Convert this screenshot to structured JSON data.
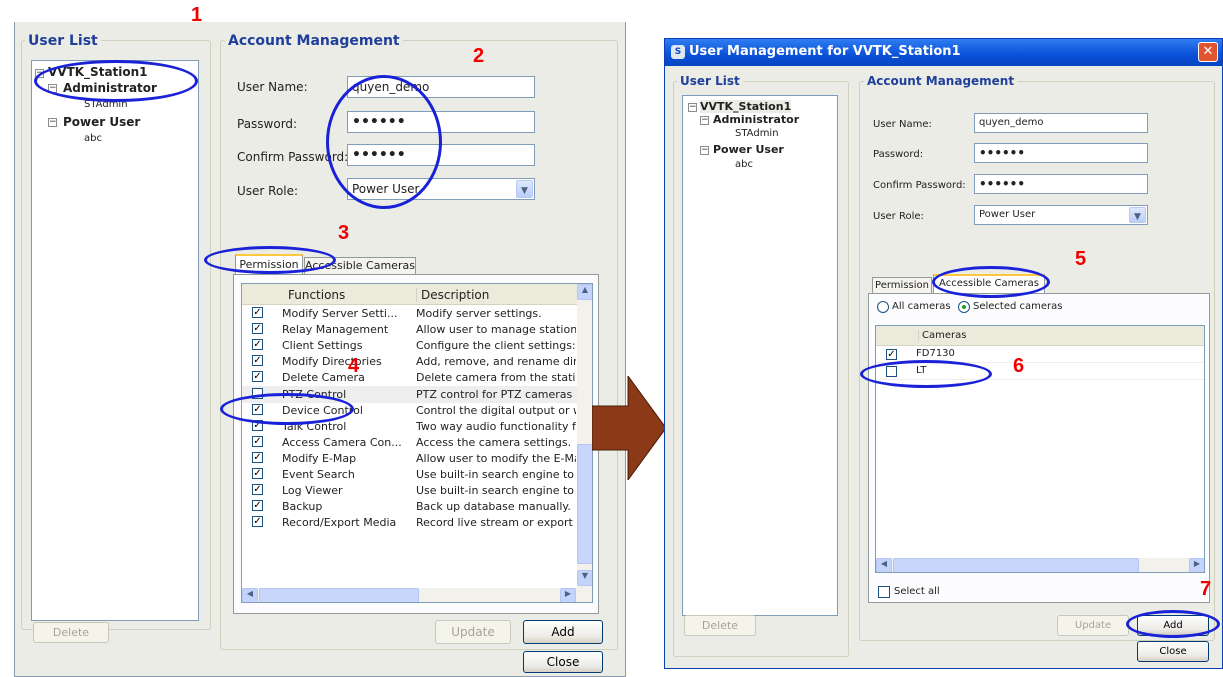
{
  "left": {
    "user_list_title": "User List",
    "tree": {
      "station": "VVTK_Station1",
      "group1": "Administrator",
      "group1_user": "STAdmin",
      "group2": "Power User",
      "group2_user": "abc"
    },
    "delete_label": "Delete",
    "account_title": "Account Management",
    "form": {
      "user_name_label": "User Name:",
      "user_name_value": "quyen_demo",
      "password_label": "Password:",
      "password_value": "••••••",
      "confirm_label": "Confirm Password:",
      "confirm_value": "••••••",
      "role_label": "User Role:",
      "role_value": "Power User"
    },
    "tabs": {
      "permission": "Permission",
      "cameras": "Accessible Cameras"
    },
    "columns": {
      "functions": "Functions",
      "description": "Description"
    },
    "permissions": [
      {
        "checked": true,
        "name": "Modify Server Setti...",
        "desc": "Modify server settings."
      },
      {
        "checked": true,
        "name": "Relay Management",
        "desc": "Allow user to manage station i"
      },
      {
        "checked": true,
        "name": "Client Settings",
        "desc": "Configure the client settings: :"
      },
      {
        "checked": true,
        "name": "Modify Directories",
        "desc": "Add, remove, and rename dire"
      },
      {
        "checked": true,
        "name": "Delete Camera",
        "desc": "Delete camera from the statio"
      },
      {
        "checked": false,
        "name": "PTZ Control",
        "desc": "PTZ control for PTZ cameras a"
      },
      {
        "checked": true,
        "name": "Device Control",
        "desc": "Control the digital output or w"
      },
      {
        "checked": true,
        "name": "Talk Control",
        "desc": "Two way audio functionality fc"
      },
      {
        "checked": true,
        "name": "Access Camera Con...",
        "desc": "Access the camera settings."
      },
      {
        "checked": true,
        "name": "Modify E-Map",
        "desc": "Allow user to modify the E-Ma"
      },
      {
        "checked": true,
        "name": "Event Search",
        "desc": "Use built-in search engine to s"
      },
      {
        "checked": true,
        "name": "Log Viewer",
        "desc": "Use built-in search engine to s"
      },
      {
        "checked": true,
        "name": "Backup",
        "desc": "Back up database manually."
      },
      {
        "checked": true,
        "name": "Record/Export Media",
        "desc": "Record live stream or export p"
      }
    ],
    "update_label": "Update",
    "add_label": "Add",
    "close_label": "Close"
  },
  "right": {
    "window_title": "User Management for VVTK_Station1",
    "user_list_title": "User List",
    "tree": {
      "station": "VVTK_Station1",
      "group1": "Administrator",
      "group1_user": "STAdmin",
      "group2": "Power User",
      "group2_user": "abc"
    },
    "delete_label": "Delete",
    "account_title": "Account Management",
    "form": {
      "user_name_label": "User Name:",
      "user_name_value": "quyen_demo",
      "password_label": "Password:",
      "password_value": "••••••",
      "confirm_label": "Confirm Password:",
      "confirm_value": "••••••",
      "role_label": "User Role:",
      "role_value": "Power User"
    },
    "tabs": {
      "permission": "Permission",
      "cameras": "Accessible Cameras"
    },
    "radio_all": "All cameras",
    "radio_selected": "Selected cameras",
    "radio_selected_checked": true,
    "cameras_col": "Cameras",
    "cameras": [
      {
        "checked": true,
        "name": "FD7130"
      },
      {
        "checked": false,
        "name": "LT"
      }
    ],
    "select_all": "Select all",
    "update_label": "Update",
    "add_label": "Add",
    "close_label": "Close"
  },
  "callouts": [
    "1",
    "2",
    "3",
    "4",
    "5",
    "6",
    "7"
  ],
  "colors": {
    "callout_red": "#e00000",
    "oval_blue": "#1a22d8",
    "arrow_brown": "#8b3a17",
    "title_blue": "#1f3f9a",
    "titlebar": "#0a4fd8"
  }
}
